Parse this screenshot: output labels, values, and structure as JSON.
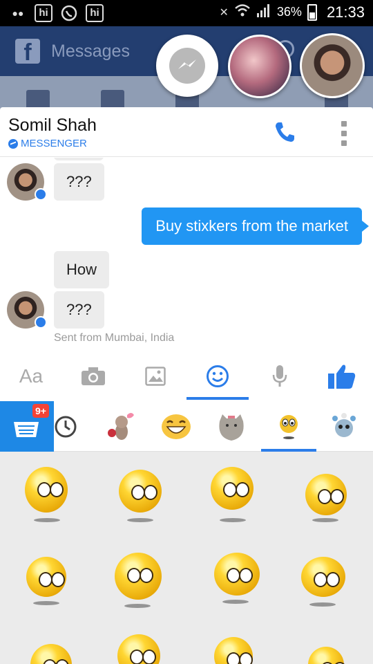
{
  "status_bar": {
    "battery": "36%",
    "time": "21:33",
    "app_icons": [
      "hike-icon",
      "whatsapp-icon",
      "hike-icon"
    ]
  },
  "background_app": {
    "title": "Messages"
  },
  "conversation": {
    "contact_name": "Somil Shah",
    "source_label": "MESSENGER",
    "messages": [
      {
        "from": "them",
        "text": "???"
      },
      {
        "from": "me",
        "text": "Buy stixkers from the market"
      },
      {
        "from": "them",
        "text": "How"
      },
      {
        "from": "them",
        "text": "???"
      }
    ],
    "location_note": "Sent from Mumbai, India"
  },
  "composer": {
    "text_button_label": "Aa",
    "buttons": [
      "text",
      "camera-icon",
      "gallery-icon",
      "emoji-icon",
      "microphone-icon",
      "thumbs-up-icon"
    ]
  },
  "sticker_tray": {
    "store_badge": "9+",
    "tabs": [
      "sticker-store",
      "recent-icon",
      "bunny-sticker-pack",
      "laughing-face-pack",
      "pusheen-cat-pack",
      "emoticon-pack",
      "floral-pack"
    ],
    "selected_tab": "emoticon-pack"
  },
  "colors": {
    "accent": "#2b7de9",
    "outgoing_bubble": "#2196f3",
    "incoming_bubble": "#ececec",
    "badge": "#f44336"
  }
}
